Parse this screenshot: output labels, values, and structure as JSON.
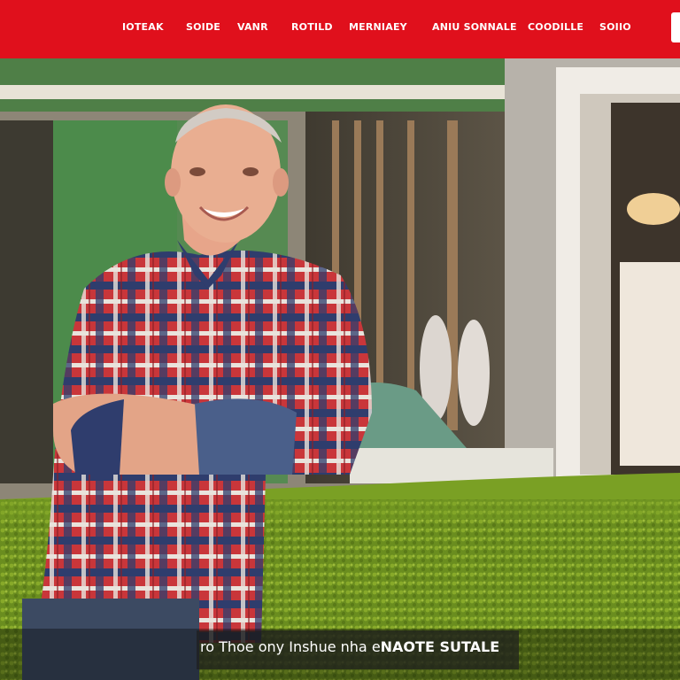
{
  "nav": {
    "items": [
      "IOTEAK",
      "SOIDE",
      "VANR",
      "ROTILD",
      "MERNIAEY",
      "ANIU SONNALE",
      "COODILLE",
      "SOIIO"
    ]
  },
  "hero": {
    "caption_lead": "ro Thoe ony",
    "caption_mid": "Inshue nha e",
    "caption_bold": "NAOTE SUTALE"
  },
  "colors": {
    "brand_red": "#e0101c",
    "hedge_green": "#6b8f1e",
    "wall_green": "#4d8a4a"
  },
  "icons": {
    "nav_cta": "menu-button"
  }
}
